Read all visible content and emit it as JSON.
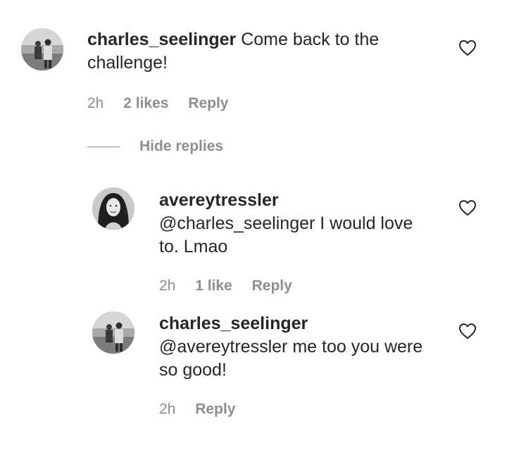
{
  "comments": [
    {
      "username": "charles_seelinger",
      "text_line1": "Come back to the",
      "text_line2": "challenge!",
      "time": "2h",
      "likes": "2 likes",
      "reply": "Reply"
    }
  ],
  "hide_replies": "Hide replies",
  "replies": [
    {
      "username": "avereytressler",
      "text_line1": "@charles_seelinger I would love",
      "text_line2": "to. Lmao",
      "time": "2h",
      "likes": "1 like",
      "reply": "Reply"
    },
    {
      "username": "charles_seelinger",
      "text_line1": "@avereytressler me too you were",
      "text_line2": "so good!",
      "time": "2h",
      "reply": "Reply"
    }
  ],
  "icons": {
    "like": "heart-outline-icon",
    "avatar": "profile-photo"
  }
}
